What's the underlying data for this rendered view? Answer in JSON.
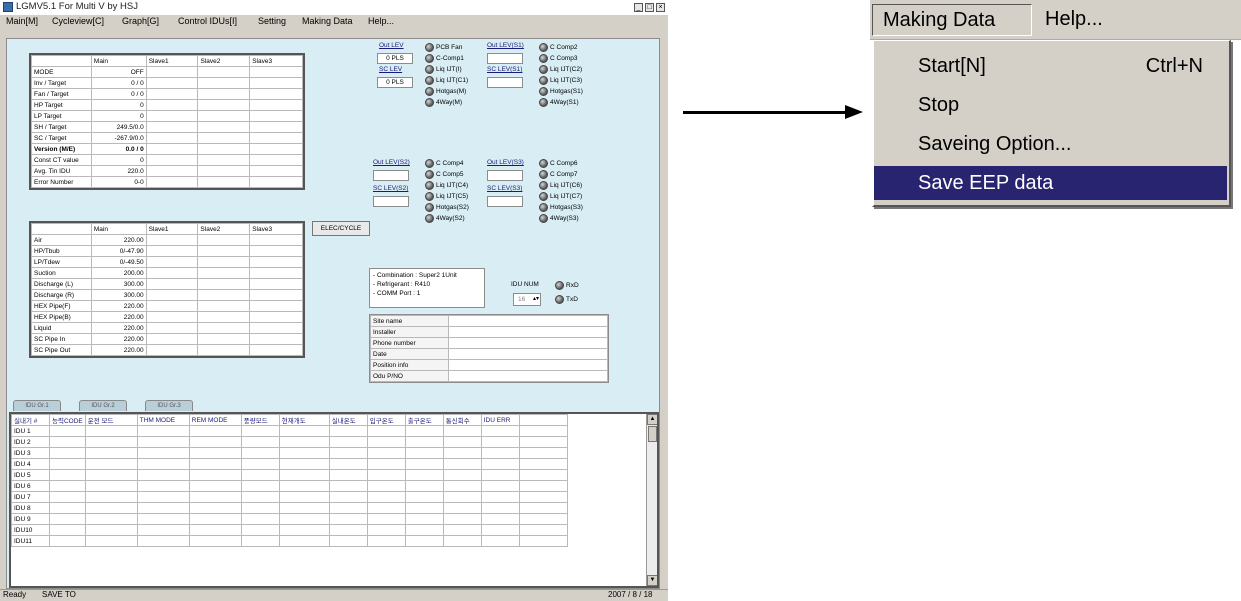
{
  "window": {
    "title": "LGMV5.1 For Multi V by HSJ",
    "controls": [
      "_",
      "□",
      "×"
    ]
  },
  "menubar": {
    "main": "Main[M]",
    "cycleview": "Cycleview[C]",
    "graph": "Graph[G]",
    "control_idus": "Control IDUs[I]",
    "setting": "Setting",
    "making_data": "Making Data",
    "help": "Help..."
  },
  "table1": {
    "headers": [
      "",
      "Main",
      "Slave1",
      "Slave2",
      "Slave3"
    ],
    "rows": [
      [
        "MODE",
        "OFF"
      ],
      [
        "Inv / Target",
        "0 / 0"
      ],
      [
        "Fan / Target",
        "0 / 0"
      ],
      [
        "HP Target",
        "0"
      ],
      [
        "LP Target",
        "0"
      ],
      [
        "SH / Target",
        "249.5/0.0"
      ],
      [
        "SC / Target",
        "-267.9/0.0"
      ],
      [
        "Version (M/E)",
        "0.0 / 0"
      ],
      [
        "Const CT value",
        "0"
      ],
      [
        "Avg. Tin IDU",
        "220.0"
      ],
      [
        "Error Number",
        "0-0"
      ]
    ]
  },
  "table2": {
    "headers": [
      "",
      "Main",
      "Slave1",
      "Slave2",
      "Slave3"
    ],
    "rows": [
      [
        "Air",
        "220.00"
      ],
      [
        "HP/Tbub",
        "0/-47.90"
      ],
      [
        "LP/Tdew",
        "0/-49.50"
      ],
      [
        "Suction",
        "200.00"
      ],
      [
        "Discharge (L)",
        "300.00"
      ],
      [
        "Discharge (R)",
        "300.00"
      ],
      [
        "HEX Pipe(F)",
        "220.00"
      ],
      [
        "HEX Pipe(B)",
        "220.00"
      ],
      [
        "Liquid",
        "220.00"
      ],
      [
        "SC Pipe In",
        "220.00"
      ],
      [
        "SC Pipe Out",
        "220.00"
      ]
    ]
  },
  "elec_cycle_button": "ELEC/CYCLE",
  "indicators": {
    "out_lev": "Out LEV",
    "out_lev_value": "0 PLS",
    "sc_lev": "SC LEV",
    "sc_lev_value": "0 PLS",
    "out_lev_s1": "Out LEV(S1)",
    "sc_lev_s1": "SC LEV(S1)",
    "out_lev_s2": "Out LEV(S2)",
    "sc_lev_s2": "SC LEV(S2)",
    "out_lev_s3": "Out LEV(S3)",
    "sc_lev_s3": "SC LEV(S3)",
    "group_main": [
      "PCB Fan",
      "C-Comp1",
      "Liq IJT(I)",
      "Liq IJT(C1)",
      "Hotgas(M)",
      "4Way(M)"
    ],
    "group_s1": [
      "C Comp2",
      "C Comp3",
      "Liq IJT(C2)",
      "Liq IJT(C3)",
      "Hotgas(S1)",
      "4Way(S1)"
    ],
    "group_s2": [
      "C Comp4",
      "C Comp5",
      "Liq IJT(C4)",
      "Liq IJT(C5)",
      "Hotgas(S2)",
      "4Way(S2)"
    ],
    "group_s3": [
      "C Comp6",
      "C Comp7",
      "Liq IJT(C6)",
      "Liq IJT(C7)",
      "Hotgas(S3)",
      "4Way(S3)"
    ]
  },
  "info": {
    "combination": "- Combination : Super2 1Unit",
    "refrigerant": "- Refrigerant : R410",
    "comm_port": "- COMM Port : 1",
    "idu_num_label": "IDU NUM",
    "idu_num_value": "16",
    "rxd": "RxD",
    "txd": "TxD"
  },
  "site": {
    "fields": [
      "Site name",
      "Installer",
      "Phone number",
      "Date",
      "Position info",
      "Odu P/NO"
    ]
  },
  "tabs": [
    "IDU Gr.1",
    "IDU Gr.2",
    "IDU Gr.3"
  ],
  "idu_table": {
    "headers": [
      "실내기 #",
      "능력CODE",
      "운전 모드",
      "THM MODE",
      "REM MODE",
      "풍량모드",
      "현재개도",
      "실내온도",
      "입구온도",
      "출구온도",
      "통신회수",
      "IDU ERR",
      ""
    ],
    "rows": [
      "IDU 1",
      "IDU 2",
      "IDU 3",
      "IDU 4",
      "IDU 5",
      "IDU 6",
      "IDU 7",
      "IDU 8",
      "IDU 9",
      "IDU10",
      "IDU11"
    ]
  },
  "statusbar": {
    "ready": "Ready",
    "message": "SAVE TO",
    "date": "2007 / 8 / 18"
  },
  "zoom": {
    "menu_open": "Making Data",
    "menu_help": "Help...",
    "items": [
      {
        "label": "Start[N]",
        "shortcut": "Ctrl+N"
      },
      {
        "label": "Stop",
        "shortcut": ""
      },
      {
        "label": "Saveing Option...",
        "shortcut": ""
      },
      {
        "label": "Save EEP data",
        "shortcut": ""
      }
    ]
  }
}
